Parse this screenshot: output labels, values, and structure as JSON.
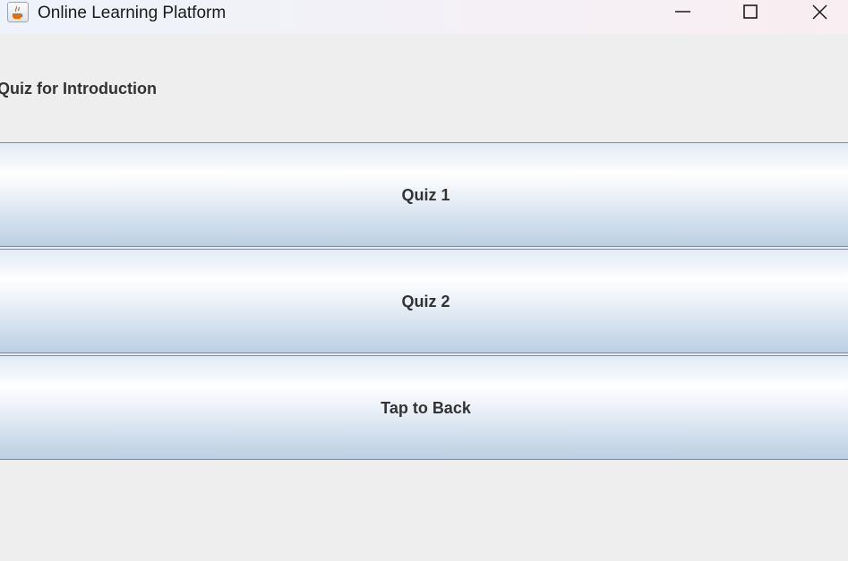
{
  "window": {
    "title": "Online Learning Platform",
    "app_icon": "java-cup-icon",
    "controls": {
      "minimize_icon": "minimize-icon",
      "maximize_icon": "maximize-icon",
      "close_icon": "close-icon"
    }
  },
  "main": {
    "heading": "Quiz for Introduction",
    "buttons": [
      {
        "label": "Quiz 1"
      },
      {
        "label": "Quiz 2"
      },
      {
        "label": "Tap to Back"
      }
    ]
  },
  "colors": {
    "background": "#eeeeee",
    "button_border": "#7a8aa3",
    "button_gradient_bottom": "#bccfe2",
    "text": "#333333"
  }
}
